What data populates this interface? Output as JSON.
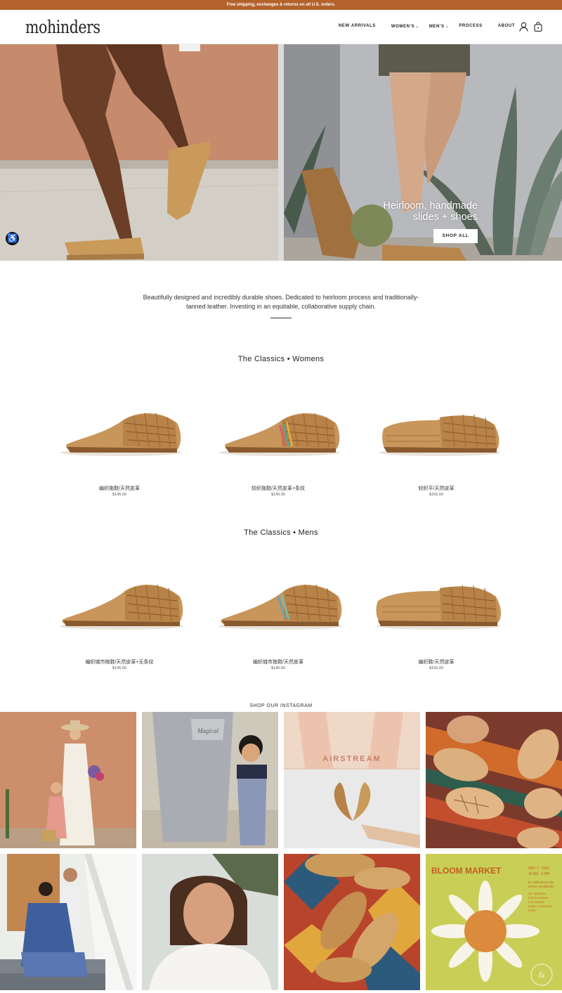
{
  "announcement": "Free shipping, exchanges & returns on all U.S. orders.",
  "brand": "mohinders",
  "nav": [
    {
      "label": "NEW ARRIVALS",
      "dropdown": false
    },
    {
      "label": "WOMEN'S",
      "dropdown": true
    },
    {
      "label": "MEN'S",
      "dropdown": true
    },
    {
      "label": "PROCESS",
      "dropdown": false
    },
    {
      "label": "ABOUT",
      "dropdown": false
    }
  ],
  "header_icons": [
    "user-icon",
    "bag-icon"
  ],
  "hero": {
    "heading_line1": "Heirloom, handmade",
    "heading_line2": "slides + shoes",
    "cta": "SHOP ALL"
  },
  "accessibility_icon": "accessibility-icon",
  "intro": "Beautifully designed and incredibly durable shoes. Dedicated to heirloom process and traditionally-tanned leather. Investing in an equitable, collaborative supply chain.",
  "womens": {
    "title": "The Classics • Womens",
    "products": [
      {
        "name": "编织拖鞋/天然皮革",
        "price": "$145.00"
      },
      {
        "name": "较织拖鞋/天然皮革+条纹",
        "price": "$145.00"
      },
      {
        "name": "较织平/天然皮革",
        "price": "$155.00"
      }
    ]
  },
  "mens": {
    "title": "The Classics • Mens",
    "products": [
      {
        "name": "编织城市拖鞋/天然皮革+无条纹",
        "price": "$145.00"
      },
      {
        "name": "编织城市拖鞋/天然皮革",
        "price": "$145.00"
      },
      {
        "name": "编织鞋/天然皮革",
        "price": "$155.00"
      }
    ]
  },
  "instagram": {
    "title": "SHOP OUR INSTAGRAM",
    "tile6_sign": "AIRSTREAM",
    "poster": {
      "title": "BLOOM MARKET",
      "date": "MAY 7 · 2022",
      "time": "10 AM - 5 PM",
      "venue_line1": "EL PRESIDIO DE",
      "venue_line2": "SANTA BARBARA",
      "lines": [
        "40+ MAKERS",
        "FOOD & DRINK",
        "LIVE MUSIC",
        "FAMILY FRIENDLY",
        "FREE"
      ]
    }
  },
  "colors": {
    "announcement_bg": "#b3622b",
    "leather": "#c99a5a",
    "text": "#222222"
  }
}
